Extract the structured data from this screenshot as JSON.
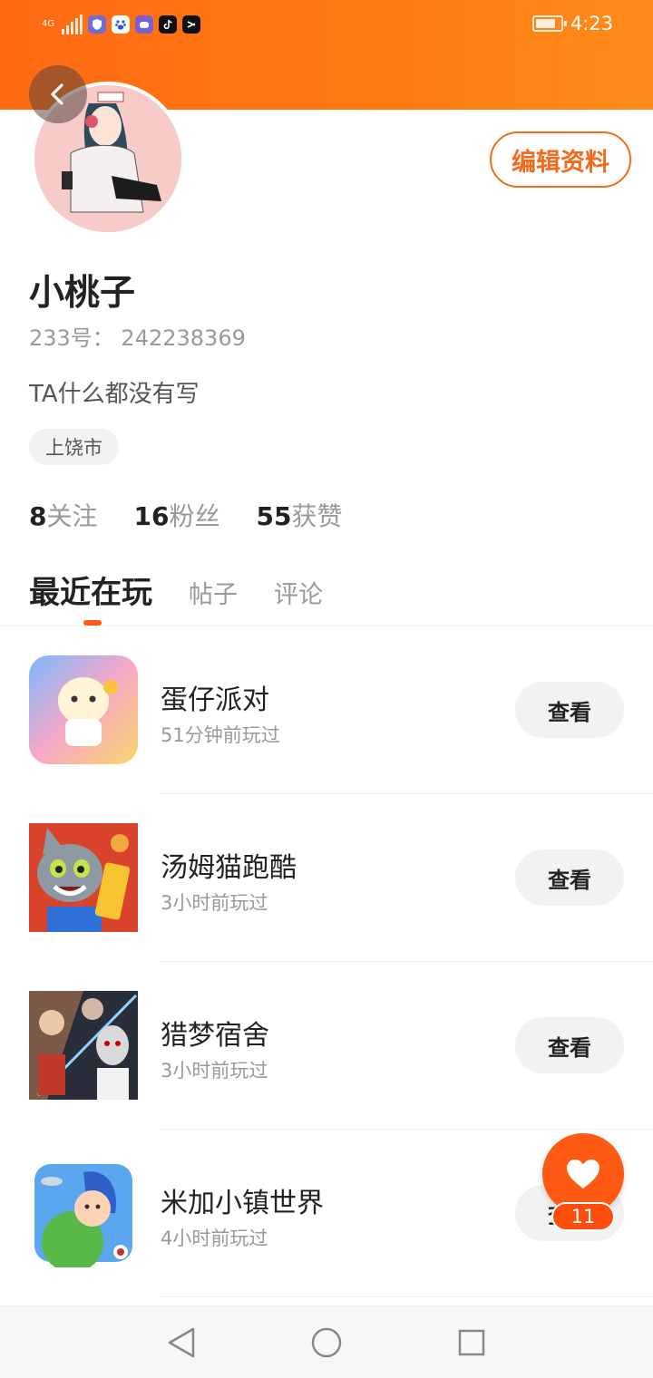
{
  "status_bar": {
    "network": "4G",
    "time": "4:23",
    "battery_level": 0.8,
    "apps": [
      "shield-app-icon",
      "baidu-app-icon",
      "game-app-icon",
      "tiktok-app-icon",
      "capcut-app-icon"
    ]
  },
  "header": {
    "accent_color": "#ff6a13",
    "edit_profile_label": "编辑资料"
  },
  "profile": {
    "username": "小桃子",
    "id_text": "233号： 242238369",
    "bio": "TA什么都没有写",
    "location": "上饶市",
    "stats": [
      {
        "num": "8",
        "label": "关注"
      },
      {
        "num": "16",
        "label": "粉丝"
      },
      {
        "num": "55",
        "label": "获赞"
      }
    ]
  },
  "tabs": [
    {
      "label": "最近在玩",
      "active": true
    },
    {
      "label": "帖子",
      "active": false
    },
    {
      "label": "评论",
      "active": false
    }
  ],
  "games": [
    {
      "name": "蛋仔派对",
      "time": "51分钟前玩过",
      "button": "查看",
      "icon": "eggy-party-icon"
    },
    {
      "name": "汤姆猫跑酷",
      "time": "3小时前玩过",
      "button": "查看",
      "icon": "tom-cat-run-icon"
    },
    {
      "name": "猎梦宿舍",
      "time": "3小时前玩过",
      "button": "查看",
      "icon": "dream-hunter-icon"
    },
    {
      "name": "米加小镇世界",
      "time": "4小时前玩过",
      "button": "查看",
      "icon": "miga-town-icon"
    }
  ],
  "like_fab": {
    "count": "11"
  },
  "nav": [
    "back-nav-icon",
    "home-nav-icon",
    "recents-nav-icon"
  ]
}
